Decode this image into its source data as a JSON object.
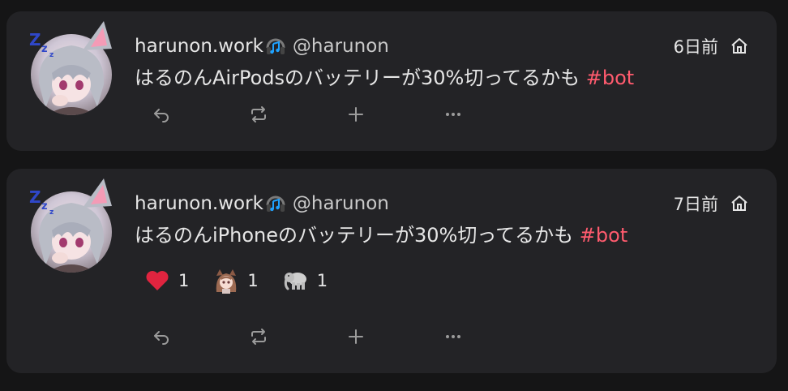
{
  "notes": [
    {
      "display_name": "harunon.work",
      "username": "@harunon",
      "time": "6日前",
      "text_main": "はるのんAirPodsのバッテリーが30%切ってるかも ",
      "hashtag": "#bot",
      "visibility_icon": "home-icon",
      "reactions": []
    },
    {
      "display_name": "harunon.work",
      "username": "@harunon",
      "time": "7日前",
      "text_main": "はるのんiPhoneのバッテリーが30%切ってるかも ",
      "hashtag": "#bot",
      "visibility_icon": "home-icon",
      "reactions": [
        {
          "icon": "red-heart-icon",
          "count": "1"
        },
        {
          "icon": "anime-girl-emoji-icon",
          "count": "1"
        },
        {
          "icon": "elephant-emoji-icon",
          "count": "1"
        }
      ]
    }
  ],
  "colors": {
    "background": "#151516",
    "card": "#232326",
    "hashtag": "#ff5b6e",
    "heart": "#e0243f",
    "text": "#e6e6e6"
  },
  "actions": [
    "reply-icon",
    "renote-icon",
    "plus-icon",
    "more-icon"
  ]
}
